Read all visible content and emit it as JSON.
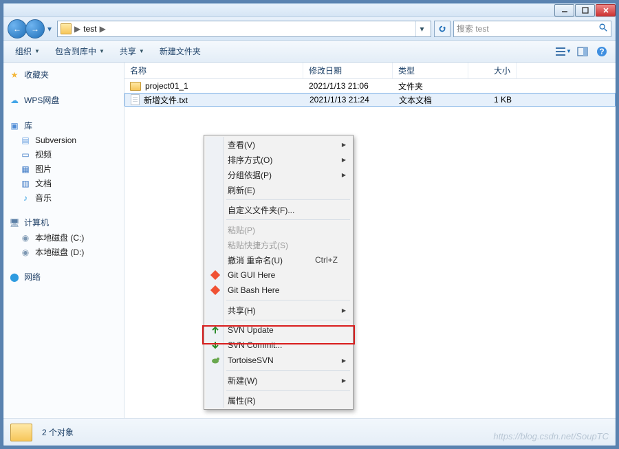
{
  "titlebar": {
    "minimize": "minimize",
    "maximize": "maximize",
    "close": "close"
  },
  "breadcrumb": {
    "item": "test",
    "sep": "▶",
    "dropdown_hint": "▾"
  },
  "search": {
    "placeholder": "搜索 test"
  },
  "toolbar": {
    "organize": "组织",
    "include": "包含到库中",
    "share": "共享",
    "newfolder": "新建文件夹"
  },
  "sidebar": {
    "favorites": "收藏夹",
    "wps": "WPS网盘",
    "libraries": "库",
    "lib_items": [
      "Subversion",
      "视频",
      "图片",
      "文档",
      "音乐"
    ],
    "computer": "计算机",
    "drives": [
      "本地磁盘 (C:)",
      "本地磁盘 (D:)"
    ],
    "network": "网络"
  },
  "columns": {
    "name": "名称",
    "date": "修改日期",
    "type": "类型",
    "size": "大小"
  },
  "rows": [
    {
      "name": "project01_1",
      "date": "2021/1/13 21:06",
      "type": "文件夹",
      "size": "",
      "kind": "folder"
    },
    {
      "name": "新增文件.txt",
      "date": "2021/1/13 21:24",
      "type": "文本文档",
      "size": "1 KB",
      "kind": "txt",
      "selected": true
    }
  ],
  "status": {
    "count": "2 个对象"
  },
  "watermark": "https://blog.csdn.net/SoupTC",
  "context_menu": [
    {
      "label": "查看(V)",
      "sub": true
    },
    {
      "label": "排序方式(O)",
      "sub": true
    },
    {
      "label": "分组依据(P)",
      "sub": true
    },
    {
      "label": "刷新(E)"
    },
    {
      "sep": true
    },
    {
      "label": "自定义文件夹(F)..."
    },
    {
      "sep": true
    },
    {
      "label": "粘贴(P)",
      "disabled": true
    },
    {
      "label": "粘贴快捷方式(S)",
      "disabled": true
    },
    {
      "label": "撤消 重命名(U)",
      "shortcut": "Ctrl+Z"
    },
    {
      "label": "Git GUI Here",
      "icon": "git"
    },
    {
      "label": "Git Bash Here",
      "icon": "git"
    },
    {
      "sep": true
    },
    {
      "label": "共享(H)",
      "sub": true
    },
    {
      "sep": true
    },
    {
      "label": "SVN Update",
      "icon": "svn-update"
    },
    {
      "label": "SVN Commit...",
      "icon": "svn-commit"
    },
    {
      "label": "TortoiseSVN",
      "icon": "tortoise",
      "sub": true
    },
    {
      "sep": true
    },
    {
      "label": "新建(W)",
      "sub": true
    },
    {
      "sep": true
    },
    {
      "label": "属性(R)"
    }
  ]
}
